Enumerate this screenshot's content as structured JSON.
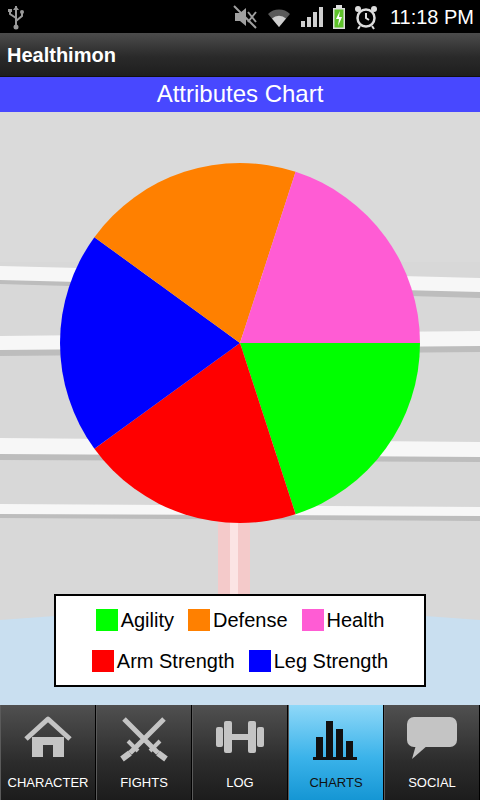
{
  "status_bar": {
    "time": "11:18 PM"
  },
  "app": {
    "title": "Healthimon"
  },
  "header": {
    "title": "Attributes Chart"
  },
  "chart": {
    "slices": [
      {
        "value": 20,
        "color": "#00ff00"
      },
      {
        "value": 20,
        "color": "#ff0000"
      },
      {
        "value": 20,
        "color": "#0000ff"
      },
      {
        "value": 20,
        "color": "#ff8000"
      },
      {
        "value": 20,
        "color": "#ff5cd4"
      }
    ],
    "legend": [
      {
        "label": "Agility",
        "color": "#00ff00"
      },
      {
        "label": "Defense",
        "color": "#ff8000"
      },
      {
        "label": "Health",
        "color": "#ff5cd4"
      },
      {
        "label": "Arm Strength",
        "color": "#ff0000"
      },
      {
        "label": "Leg Strength",
        "color": "#0000ff"
      }
    ]
  },
  "tabs": [
    {
      "label": "CHARACTER",
      "selected": false
    },
    {
      "label": "FIGHTS",
      "selected": false
    },
    {
      "label": "LOG",
      "selected": false
    },
    {
      "label": "CHARTS",
      "selected": true
    },
    {
      "label": "SOCIAL",
      "selected": false
    }
  ]
}
